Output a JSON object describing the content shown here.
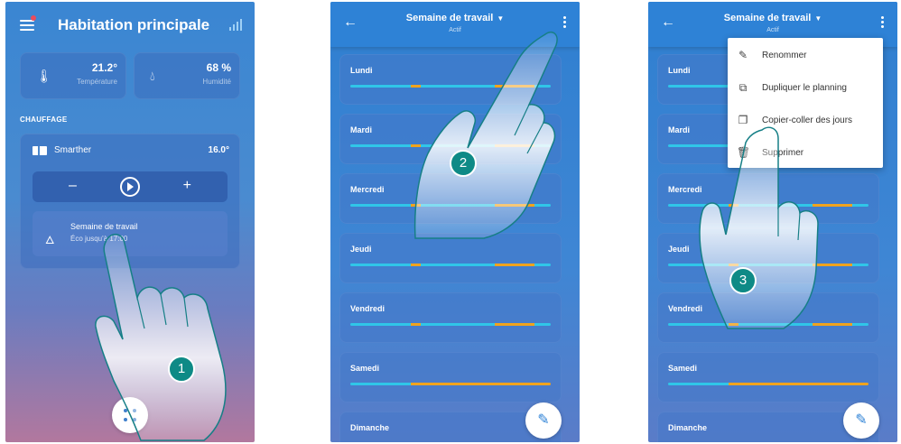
{
  "phone1": {
    "title": "Habitation principale",
    "temperature": {
      "value": "21.2°",
      "label": "Température"
    },
    "humidity": {
      "value": "68 %",
      "label": "Humidité"
    },
    "section_label": "CHAUFFAGE",
    "device": {
      "name": "Smarther",
      "temp": "16.0°"
    },
    "controls": {
      "minus": "–",
      "plus": "+"
    },
    "program": {
      "name": "Semaine de travail",
      "subtitle": "Éco jusqu'à 17:00"
    },
    "step": "1"
  },
  "phone2": {
    "title": "Semaine de travail",
    "subtitle": "Actif",
    "step": "2"
  },
  "phone3": {
    "title": "Semaine de travail",
    "subtitle": "Actif",
    "step": "3",
    "menu": [
      {
        "label": "Renommer",
        "icon": "pencil-icon"
      },
      {
        "label": "Dupliquer le planning",
        "icon": "duplicate-icon"
      },
      {
        "label": "Copier-coller des jours",
        "icon": "copy-icon"
      },
      {
        "label": "Supprimer",
        "icon": "trash-icon"
      }
    ]
  },
  "days": [
    "Lundi",
    "Mardi",
    "Mercredi",
    "Jeudi",
    "Vendredi",
    "Samedi",
    "Dimanche"
  ],
  "schedule_segments": [
    [
      [
        0.3,
        "c"
      ],
      [
        0.05,
        "o"
      ],
      [
        0.37,
        "c"
      ],
      [
        0.2,
        "o"
      ],
      [
        0.08,
        "c"
      ]
    ],
    [
      [
        0.3,
        "c"
      ],
      [
        0.05,
        "o"
      ],
      [
        0.37,
        "c"
      ],
      [
        0.2,
        "o"
      ],
      [
        0.08,
        "c"
      ]
    ],
    [
      [
        0.3,
        "c"
      ],
      [
        0.05,
        "o"
      ],
      [
        0.37,
        "c"
      ],
      [
        0.2,
        "o"
      ],
      [
        0.08,
        "c"
      ]
    ],
    [
      [
        0.3,
        "c"
      ],
      [
        0.05,
        "o"
      ],
      [
        0.37,
        "c"
      ],
      [
        0.2,
        "o"
      ],
      [
        0.08,
        "c"
      ]
    ],
    [
      [
        0.3,
        "c"
      ],
      [
        0.05,
        "o"
      ],
      [
        0.37,
        "c"
      ],
      [
        0.2,
        "o"
      ],
      [
        0.08,
        "c"
      ]
    ],
    [
      [
        0.3,
        "c"
      ],
      [
        0.7,
        "o"
      ]
    ],
    [
      [
        0.3,
        "c"
      ],
      [
        0.7,
        "o"
      ]
    ]
  ],
  "colors": {
    "comfort": "#30c6e8",
    "eco": "#f0a31e",
    "badge": "#0e8a86",
    "topbar": "#2e82d6"
  }
}
